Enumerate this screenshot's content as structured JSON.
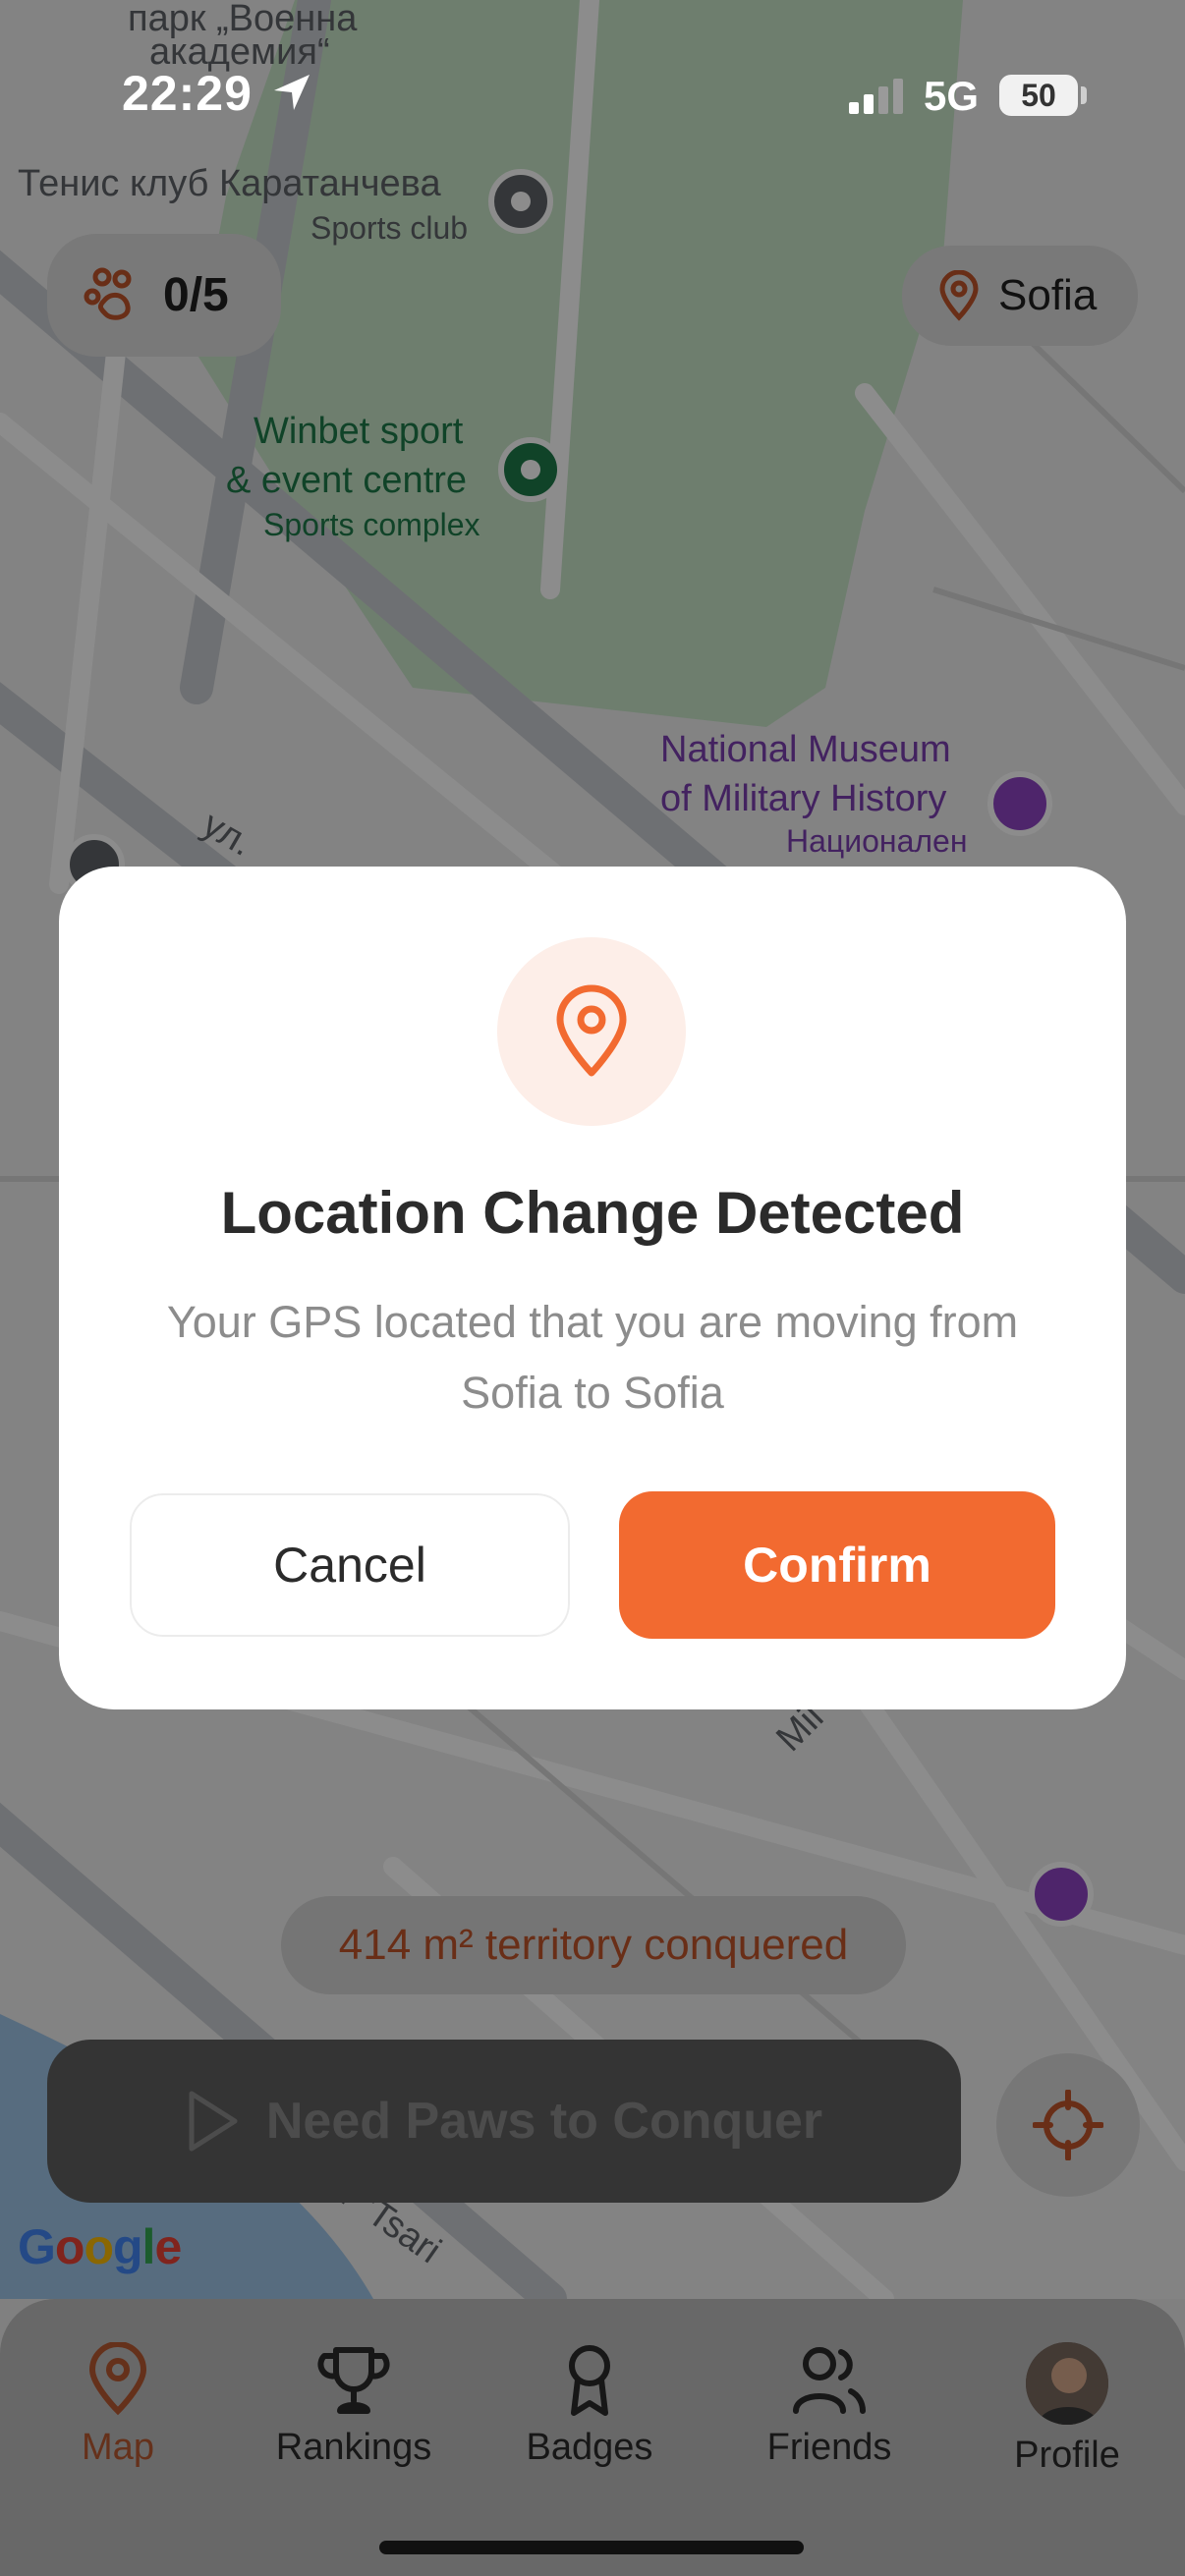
{
  "status_bar": {
    "time": "22:29",
    "network": "5G",
    "battery": "50"
  },
  "map": {
    "labels": {
      "park": "парк „Военна",
      "park2": "академия“",
      "tennis_club": "Тенис клуб Каратанчева",
      "tennis_club_type": "Sports club",
      "winbet_line1": "Winbet sport",
      "winbet_line2": "& event centre",
      "winbet_type": "Sports complex",
      "museum_line1": "National Museum",
      "museum_line2": "of Military History",
      "museum_local": "Национален",
      "street1": "ул.",
      "street2": "Mil",
      "street3": "d \"Tsari"
    },
    "google": "Google"
  },
  "header": {
    "paws_count": "0/5",
    "city": "Sofia"
  },
  "modal": {
    "icon": "map-pin-icon",
    "title": "Location Change Detected",
    "body": "Your GPS located that you are moving from Sofia to Sofia",
    "cancel_label": "Cancel",
    "confirm_label": "Confirm"
  },
  "territory": "414 m² territory conquered",
  "conquer_button": "Need Paws to Conquer",
  "tabs": [
    {
      "label": "Map",
      "icon": "map-pin-icon",
      "active": true
    },
    {
      "label": "Rankings",
      "icon": "trophy-icon",
      "active": false
    },
    {
      "label": "Badges",
      "icon": "award-icon",
      "active": false
    },
    {
      "label": "Friends",
      "icon": "users-icon",
      "active": false
    },
    {
      "label": "Profile",
      "icon": "avatar",
      "active": false
    }
  ],
  "colors": {
    "accent": "#f26a30",
    "park_green": "#c8e6c9",
    "poi_purple": "#8e44c4"
  }
}
